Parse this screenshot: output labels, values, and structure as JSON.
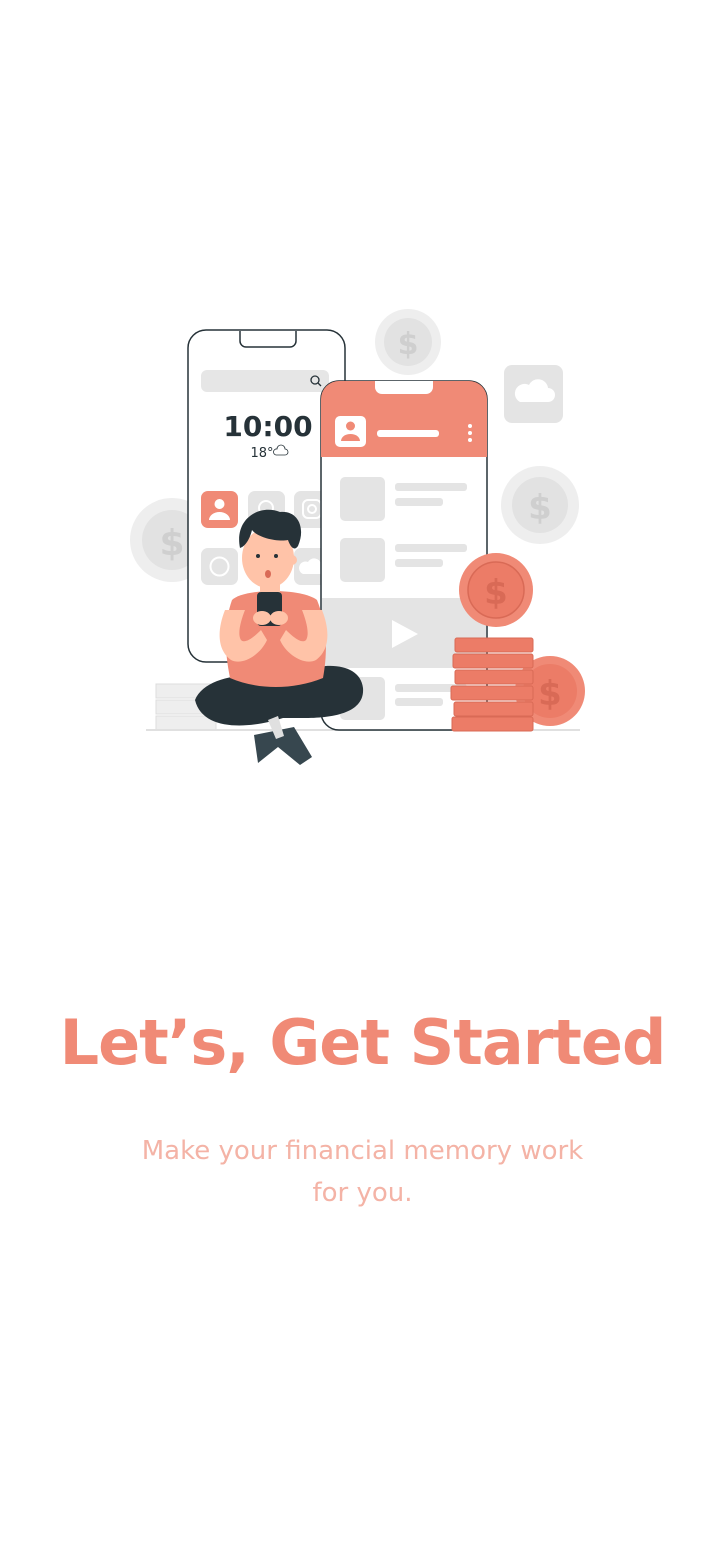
{
  "onboarding": {
    "title": "Let’s, Get Started",
    "subtitle": "Make your financial memory work for you."
  },
  "illustration": {
    "phone_time": "10:00",
    "phone_weather": "18°",
    "coin_symbol": "$"
  },
  "colors": {
    "accent": "#f08a76",
    "accent_light": "#f4b3a6",
    "neutral": "#e4e4e4",
    "dark": "#263238"
  }
}
